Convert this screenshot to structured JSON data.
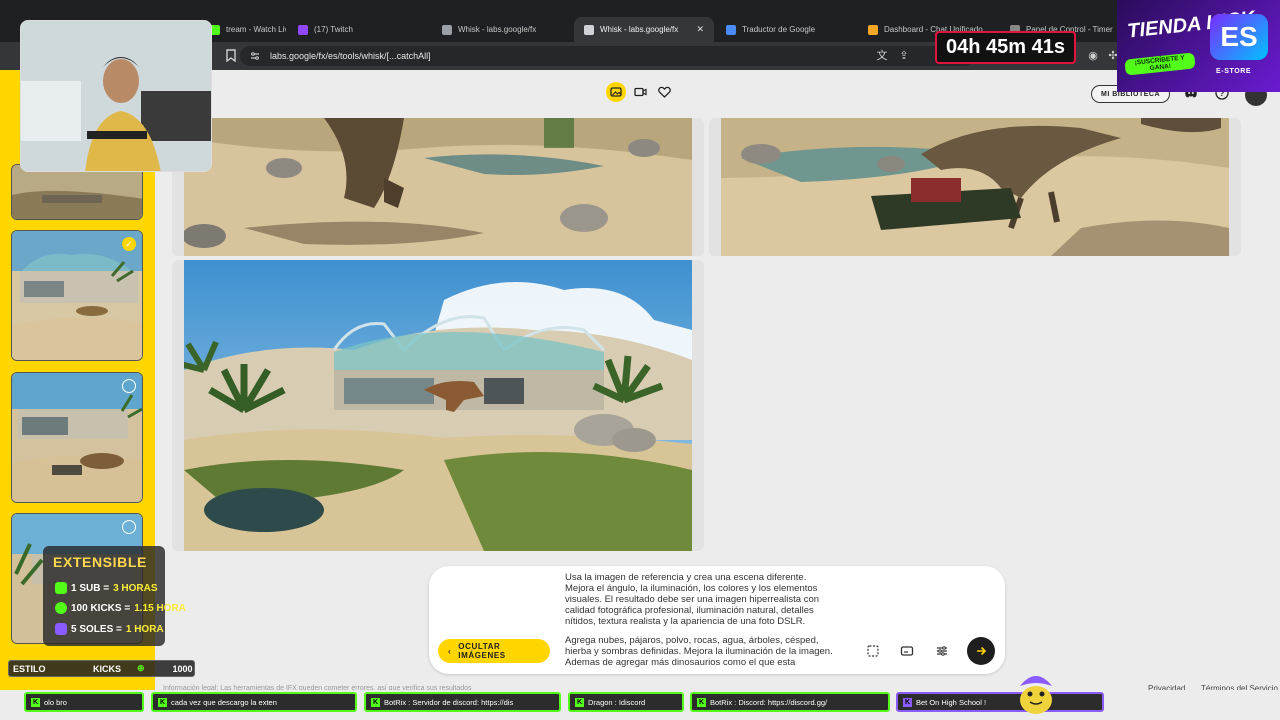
{
  "browser": {
    "tabs": [
      {
        "label": "tream - Watch Liv",
        "color": "#53fc18"
      },
      {
        "label": "(17) Twitch",
        "color": "#9146ff"
      },
      {
        "label": "Whisk - labs.google/fx",
        "color": "#cccccc"
      },
      {
        "label": "Whisk - labs.google/fx",
        "color": "#cccccc",
        "active": true
      },
      {
        "label": "Traductor de Google",
        "color": "#4a8af4"
      },
      {
        "label": "Dashboard - Chat Unificado",
        "color": "#f5a623"
      },
      {
        "label": "Panel de Control - Timer",
        "color": "#888888"
      }
    ],
    "url": "labs.google/fx/es/tools/whisk/[...catchAll]"
  },
  "header": {
    "library_button": "MI BIBLIOTECA",
    "mode_icons": [
      "image-mode-icon",
      "video-mode-icon",
      "favorites-icon"
    ]
  },
  "sidebar": {
    "thumbnails": [
      {
        "name": "thumbnail-1",
        "selected": false
      },
      {
        "name": "thumbnail-2",
        "selected": true
      },
      {
        "name": "thumbnail-3",
        "selected": false
      },
      {
        "name": "thumbnail-4",
        "selected": false
      }
    ]
  },
  "prompt": {
    "paragraph1": "Usa la imagen de referencia y crea una escena diferente. Mejora el ángulo, la iluminación, los colores y los elementos visuales. El resultado debe ser una imagen hiperrealista con calidad fotográfica profesional, iluminación natural, detalles nítidos, textura realista y la apariencia de una foto DSLR.",
    "paragraph2": "Agrega nubes, pájaros, polvo, rocas, agua, árboles, césped, hierba y sombras definidas. Mejora la iluminación de la imagen. Ademas de agregar más dinosaurios como el que esta",
    "hide_images_button": "OCULTAR IMÁGENES"
  },
  "footer": {
    "legal": "Información legal: Las herramientas de IFX pueden cometer errores, así que verifica sus resultados",
    "privacy": "Privacidad",
    "terms": "Términos del Servicio"
  },
  "overlay": {
    "timer": "04h 45m 41s",
    "store_title": "TIENDA KICK",
    "store_subtitle": "¡SUSCRÍBETE Y GANA!",
    "store_label": "E-STORE",
    "extensible": {
      "title": "EXTENSIBLE",
      "rows": [
        {
          "left": "1 SUB = ",
          "right": "3 HORAS",
          "color": "#53fc18"
        },
        {
          "left": "100 KICKS = ",
          "right": "1.15 HORA",
          "color": "#53fc18"
        },
        {
          "left": "5 SOLES = ",
          "right": "1 HORA",
          "color": "#8a5cff"
        }
      ]
    },
    "kick_bar": {
      "left": "ESTILO",
      "mid": "KICKS",
      "value": "1000"
    },
    "ticker": [
      "olo bro",
      "cada vez que descargo la exten",
      "BotRix : Servidor de discord: https://dis",
      "Dragon : Idiscord",
      "BotRix : Discord: https://discord.gg/",
      "Bet On High School !"
    ]
  }
}
